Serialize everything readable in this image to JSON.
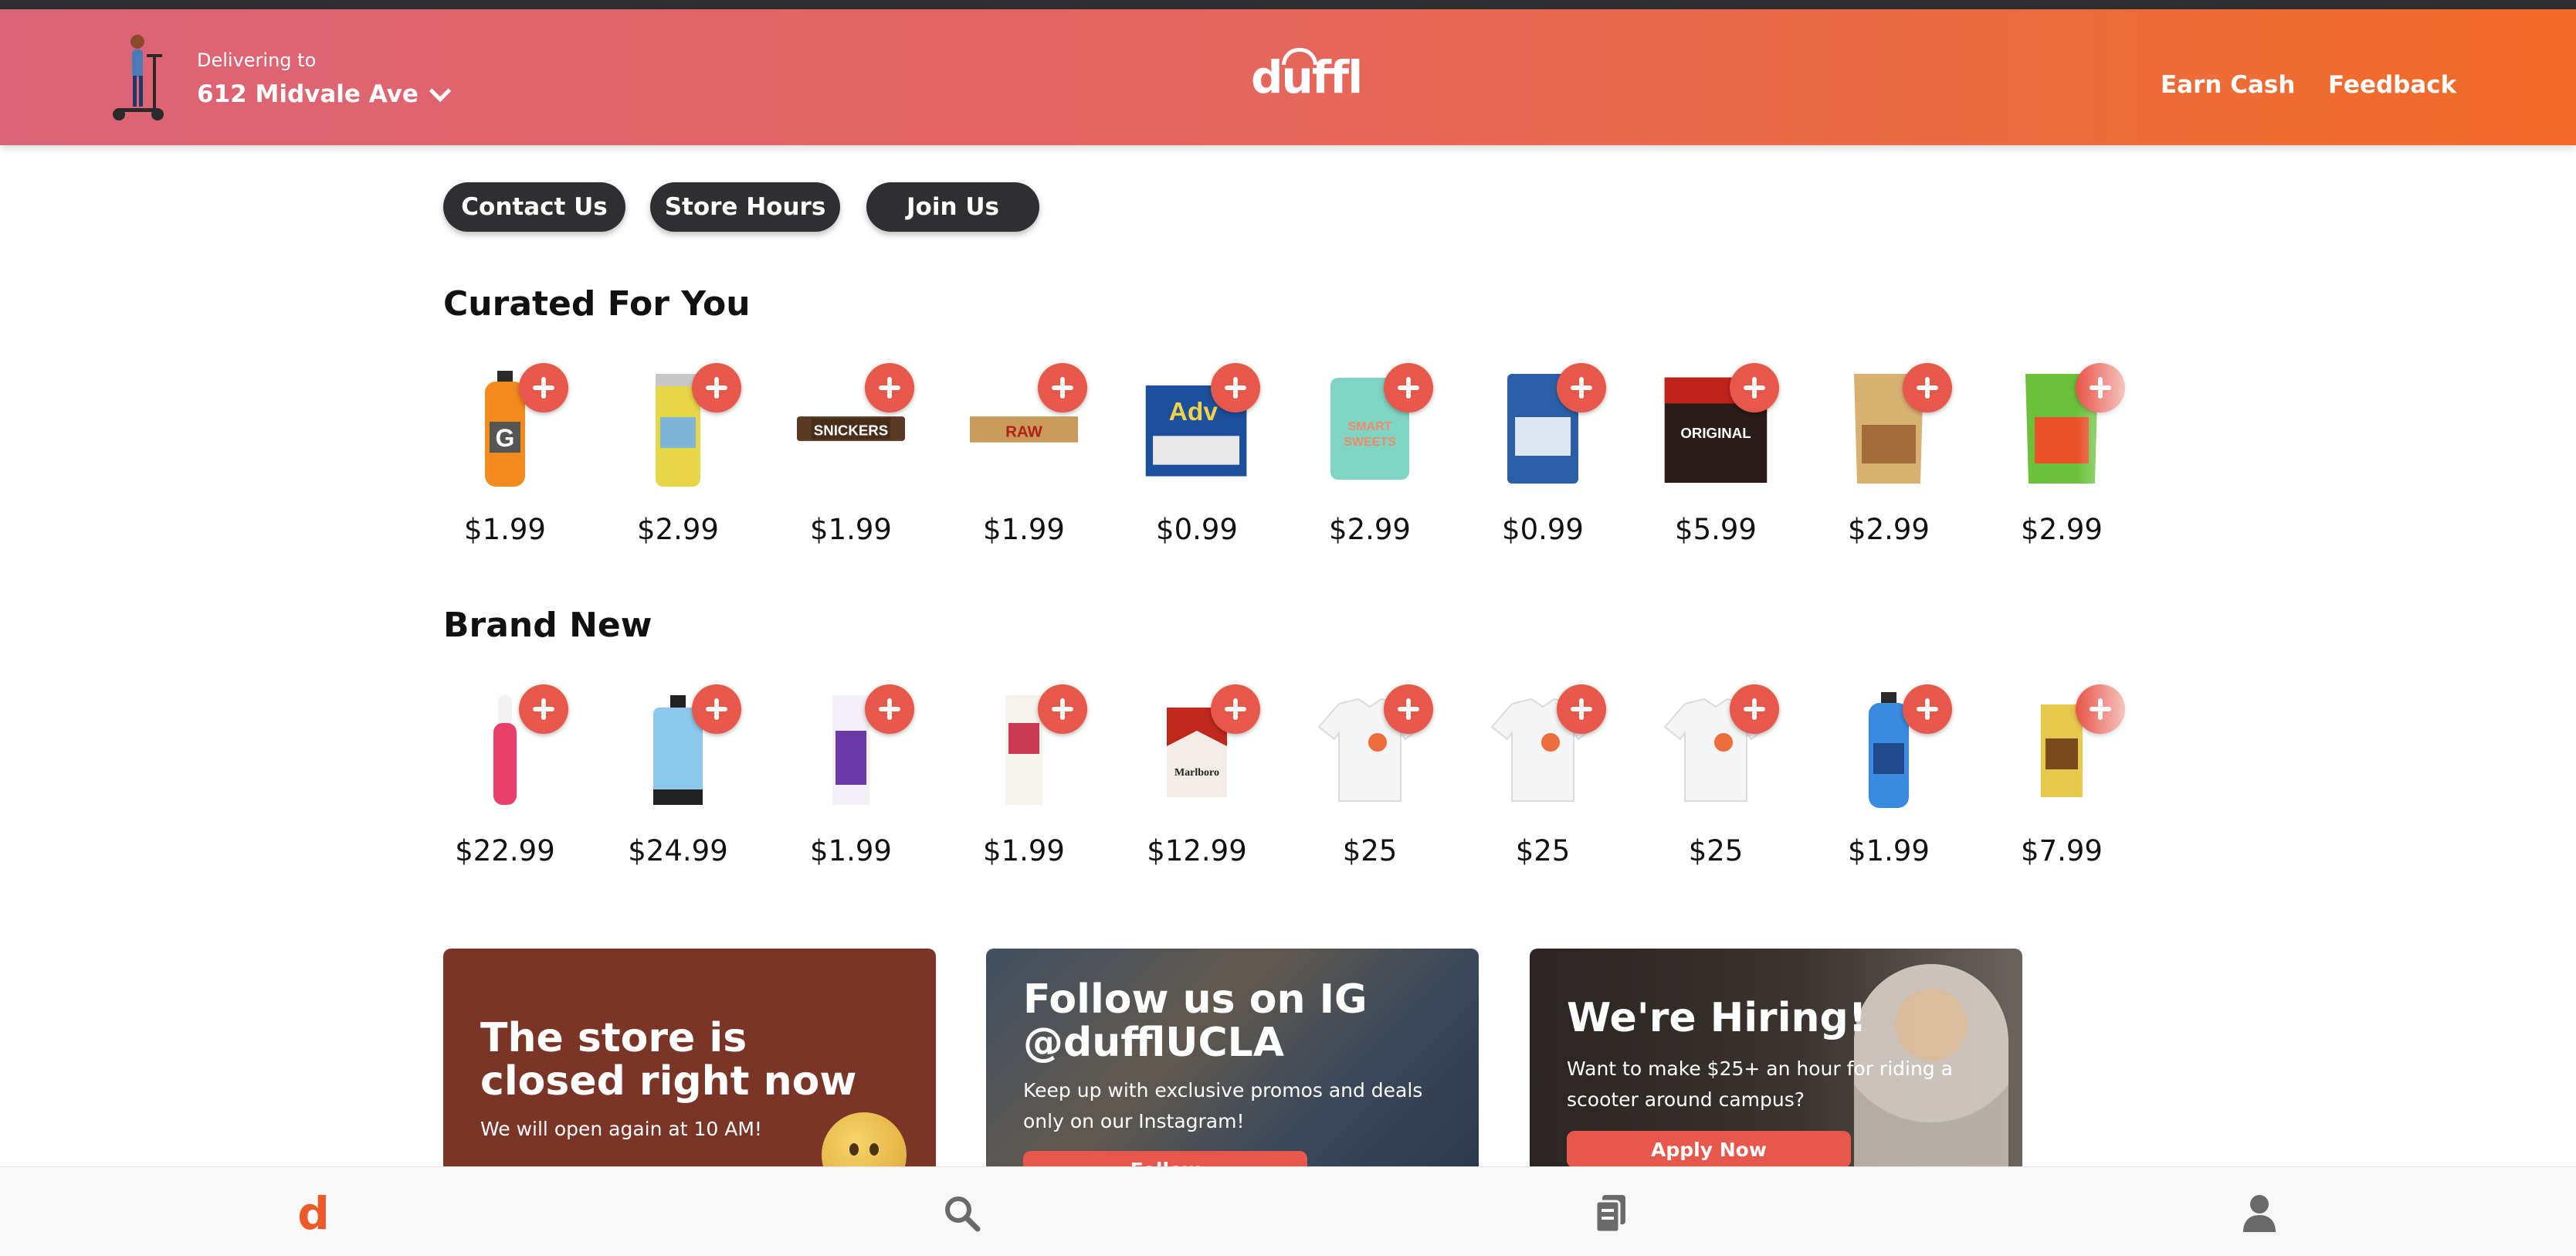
{
  "header": {
    "delivering_label": "Delivering to",
    "address": "612 Midvale Ave",
    "logo": "duffl",
    "earn_cash": "Earn Cash",
    "feedback": "Feedback"
  },
  "pills": {
    "contact": "Contact Us",
    "hours": "Store Hours",
    "join": "Join Us"
  },
  "curated": {
    "title": "Curated For You",
    "items": [
      {
        "name": "Gatorade Orange",
        "price": "$1.99"
      },
      {
        "name": "Yerba Mate Can",
        "price": "$2.99"
      },
      {
        "name": "Snickers Bar",
        "price": "$1.99"
      },
      {
        "name": "RAW Rolling Papers",
        "price": "$1.99"
      },
      {
        "name": "Advil Pack",
        "price": "$0.99"
      },
      {
        "name": "Smart Sweets",
        "price": "$2.99"
      },
      {
        "name": "Claritin Pack",
        "price": "$0.99"
      },
      {
        "name": "Jack Link's Jerky",
        "price": "$5.99"
      },
      {
        "name": "Snyder's Pretzel Pieces",
        "price": "$2.99"
      },
      {
        "name": "Doritos Flamin' Hot",
        "price": "$2.99"
      }
    ]
  },
  "brand_new": {
    "title": "Brand New",
    "items": [
      {
        "name": "Pink Vape",
        "price": "$22.99"
      },
      {
        "name": "Blue Vape Device",
        "price": "$24.99"
      },
      {
        "name": "Purple Cigarillos",
        "price": "$1.99"
      },
      {
        "name": "Swisher Cigarillos",
        "price": "$1.99"
      },
      {
        "name": "Marlboro Pack",
        "price": "$12.99"
      },
      {
        "name": "White T-Shirt 1",
        "price": "$25"
      },
      {
        "name": "White T-Shirt 2",
        "price": "$25"
      },
      {
        "name": "White T-Shirt 3",
        "price": "$25"
      },
      {
        "name": "Gatorade Blue",
        "price": "$1.99"
      },
      {
        "name": "Dutch Masters Cigar",
        "price": "$7.99"
      }
    ]
  },
  "cards": {
    "closed": {
      "title": "The store is closed right now",
      "text": "We will open again at 10 AM!"
    },
    "ig": {
      "title": "Follow us on IG @dufflUCLA",
      "text": "Keep up with exclusive promos and deals only on our Instagram!",
      "button": "Follow"
    },
    "hire": {
      "title": "We're Hiring!",
      "text": "Want to make $25+ an hour for riding a scooter around campus?",
      "button": "Apply Now"
    }
  },
  "bottom_nav": {
    "home_glyph": "d"
  },
  "colors": {
    "accent": "#e8574b",
    "header_start": "#dc6478",
    "header_end": "#f26a26",
    "pill_bg": "#2f2f31"
  }
}
